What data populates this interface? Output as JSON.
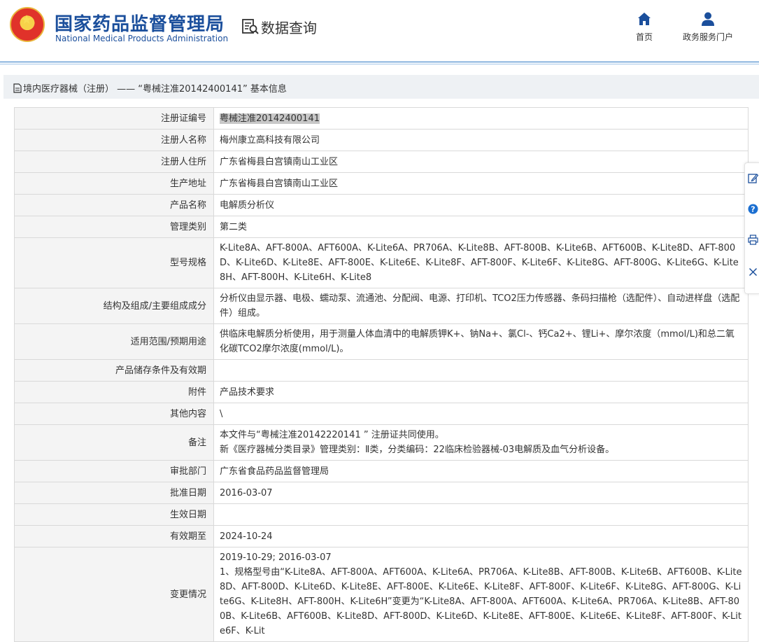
{
  "header": {
    "agency_cn": "国家药品监督管理局",
    "agency_en": "National Medical Products Administration",
    "query_label": "数据查询",
    "nav": [
      {
        "label": "首页",
        "icon": "home-icon"
      },
      {
        "label": "政务服务门户",
        "icon": "user-icon"
      }
    ]
  },
  "breadcrumb": {
    "text": "境内医疗器械（注册） ——  “粤械注准20142400141”  基本信息",
    "icon": "document-icon"
  },
  "record": {
    "rows": [
      {
        "label": "注册证编号",
        "value": "粤械注准20142400141"
      },
      {
        "label": "注册人名称",
        "value": "梅州康立高科技有限公司"
      },
      {
        "label": "注册人住所",
        "value": "广东省梅县白宫镇南山工业区"
      },
      {
        "label": "生产地址",
        "value": "广东省梅县白宫镇南山工业区"
      },
      {
        "label": "产品名称",
        "value": "电解质分析仪"
      },
      {
        "label": "管理类别",
        "value": "第二类"
      },
      {
        "label": "型号规格",
        "value": "K-Lite8A、AFT-800A、AFT600A、K-Lite6A、PR706A、K-Lite8B、AFT-800B、K-Lite6B、AFT600B、K-Lite8D、AFT-800D、K-Lite6D、K-Lite8E、AFT-800E、K-Lite6E、K-Lite8F、AFT-800F、K-Lite6F、K-Lite8G、AFT-800G、K-Lite6G、K-Lite8H、AFT-800H、K-Lite6H、K-Lite8"
      },
      {
        "label": "结构及组成/主要组成成分",
        "value": "分析仪由显示器、电极、蠕动泵、流通池、分配阀、电源、打印机、TCO2压力传感器、条码扫描枪（选配件）、自动进样盘（选配件）组成。"
      },
      {
        "label": "适用范围/预期用途",
        "value": "供临床电解质分析使用，用于测量人体血清中的电解质钾K+、钠Na+、氯Cl-、钙Ca2+、锂Li+、摩尔浓度（mmol/L)和总二氧化碳TCO2摩尔浓度(mmol/L)。"
      },
      {
        "label": "产品储存条件及有效期",
        "value": ""
      },
      {
        "label": "附件",
        "value": "产品技术要求"
      },
      {
        "label": "其他内容",
        "value": "\\"
      },
      {
        "label": "备注",
        "value_lines": [
          "本文件与“粤械注准20142220141 ” 注册证共同使用。",
          "新《医疗器械分类目录》管理类别：Ⅱ类，分类编码：22临床检验器械-03电解质及血气分析设备。"
        ]
      },
      {
        "label": "审批部门",
        "value": "广东省食品药品监督管理局"
      },
      {
        "label": "批准日期",
        "value": "2016-03-07"
      },
      {
        "label": "生效日期",
        "value": ""
      },
      {
        "label": "有效期至",
        "value": "2024-10-24"
      },
      {
        "label": "变更情况",
        "value_lines": [
          "2019-10-29; 2016-03-07",
          "1、规格型号由“K-Lite8A、AFT-800A、AFT600A、K-Lite6A、PR706A、K-Lite8B、AFT-800B、K-Lite6B、AFT600B、K-Lite8D、AFT-800D、K-Lite6D、K-Lite8E、AFT-800E、K-Lite6E、K-Lite8F、AFT-800F、K-Lite6F、K-Lite8G、AFT-800G、K-Lite6G、K-Lite8H、AFT-800H、K-Lite6H”变更为“K-Lite8A、AFT-800A、AFT600A、K-Lite6A、PR706A、K-Lite8B、AFT-800B、K-Lite6B、AFT600B、K-Lite8D、AFT-800D、K-Lite6D、K-Lite8E、AFT-800E、K-Lite6E、K-Lite8F、AFT-800F、K-Lite6F、K-Lit"
        ]
      }
    ]
  },
  "side_tools": [
    {
      "icon": "edit-icon"
    },
    {
      "icon": "help-icon"
    },
    {
      "icon": "print-icon"
    },
    {
      "icon": "close-icon"
    }
  ],
  "colors": {
    "brand": "#1b4f9c",
    "accent_line": "#2b78c3",
    "label_bg": "#f4f4f4",
    "crumb_bg": "#eef1f4"
  }
}
